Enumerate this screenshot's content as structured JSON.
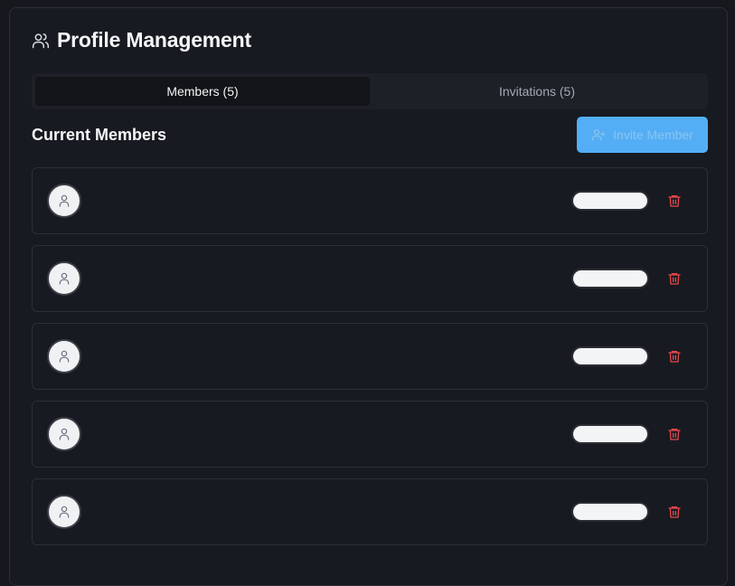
{
  "header": {
    "icon": "users-icon",
    "title": "Profile Management"
  },
  "tabs": [
    {
      "label": "Members (5)",
      "active": true
    },
    {
      "label": "Invitations (5)",
      "active": false
    }
  ],
  "section": {
    "title": "Current Members"
  },
  "invite_button": {
    "label": "Invite Member",
    "icon": "user-plus-icon"
  },
  "members": [
    {
      "avatar_icon": "user-icon",
      "delete_icon": "trash-icon"
    },
    {
      "avatar_icon": "user-icon",
      "delete_icon": "trash-icon"
    },
    {
      "avatar_icon": "user-icon",
      "delete_icon": "trash-icon"
    },
    {
      "avatar_icon": "user-icon",
      "delete_icon": "trash-icon"
    },
    {
      "avatar_icon": "user-icon",
      "delete_icon": "trash-icon"
    }
  ],
  "colors": {
    "background": "#16181d",
    "accent": "#54aef5",
    "danger": "#e5484d"
  }
}
